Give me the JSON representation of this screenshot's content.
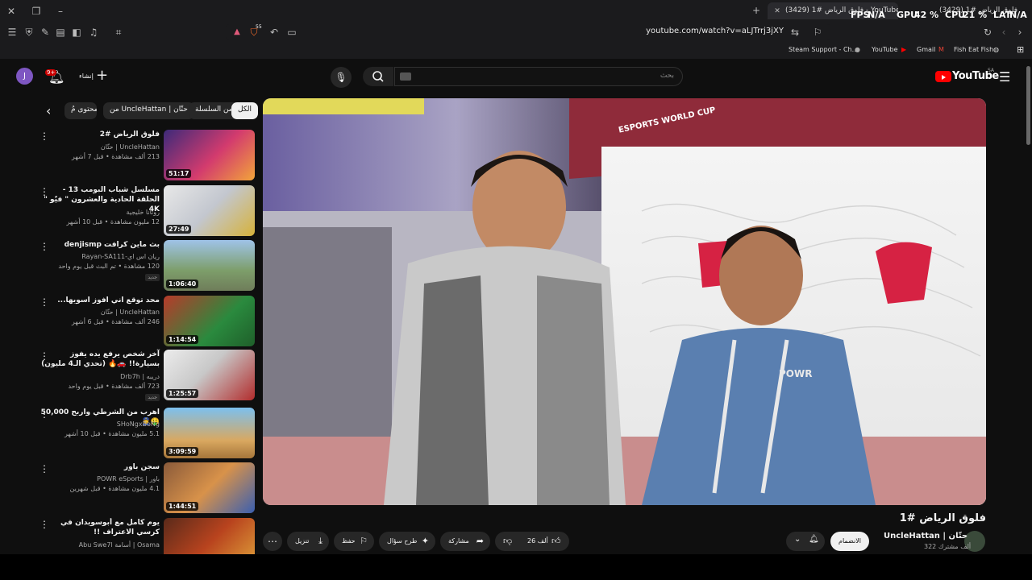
{
  "browser": {
    "tabs": [
      {
        "title": "(3429) فلوق الرياض #1 - YouTube",
        "active": true
      },
      {
        "title": "(3429) فلوق الرياض #1",
        "active": false
      }
    ],
    "perf": {
      "fps_label": "FPS",
      "fps_value": "N/A",
      "gpu_label": "GPU",
      "gpu_value": "42 %",
      "cpu_label": "CPU",
      "cpu_value": "21 %",
      "lat_label": "LAT",
      "lat_value": "N/A"
    },
    "url": "youtube.com/watch?v=aLJTrrj3jXY",
    "shield_count": "55",
    "bookmarks": [
      "Steam Support - Ch...",
      "YouTube",
      "Gmail",
      "Fish Eat Fish"
    ]
  },
  "header": {
    "logo_text": "YouTube",
    "logo_region": "SA",
    "search_placeholder": "بحث",
    "create_label": "إنشاء",
    "notif_count": "9+",
    "avatar_letter": "J"
  },
  "chips": [
    "الكل",
    "من السلسلة",
    "من UncleHattan | حتّان",
    "محتوى مُ"
  ],
  "videos": [
    {
      "title": "فلوق الرياض #2",
      "channel": "UncleHattan | حتّان",
      "meta": "213 ألف مشاهدة • قبل 7 أشهر",
      "duration": "51:17",
      "badge": ""
    },
    {
      "title": "مسلسل شباب البومب 13 - الحلقة الحادية والعشرون \" فيّو \" 4K",
      "channel": "روتانا خليجية",
      "meta": "12 مليون مشاهدة • قبل 10 أشهر",
      "duration": "27:49",
      "badge": ""
    },
    {
      "title": "بث ماين كرافت denjismp",
      "channel": "ريان اس اي-Rayan-SA111",
      "meta": "120 مشاهدة • تم البث قبل يوم واحد",
      "duration": "1:06:40",
      "badge": "جديد"
    },
    {
      "title": "محد توقع اني افوز اسويها...",
      "channel": "UncleHattan | حتّان",
      "meta": "246 ألف مشاهدة • قبل 6 أشهر",
      "duration": "1:14:54",
      "badge": ""
    },
    {
      "title": "آخر شخص يرفع يده يفوز بسيارة!! 🚗🔥 (تحدي الـ4 مليون)",
      "channel": "دريبه | Drb7h",
      "meta": "723 ألف مشاهدة • قبل يوم واحد",
      "duration": "1:25:57",
      "badge": "جديد"
    },
    {
      "title": "اهرب من الشرطي واربح 50,000 🤑👮",
      "channel": "SHoNgxBoNg",
      "meta": "5.1 مليون مشاهدة • قبل 10 أشهر",
      "duration": "3:09:59",
      "badge": ""
    },
    {
      "title": "سجن باور",
      "channel": "باور | POWR eSports",
      "meta": "4.1 مليون مشاهدة • قبل شهرين",
      "duration": "1:44:51",
      "badge": ""
    },
    {
      "title": "يوم كامل مع أبوسويدان في كرسي الاعتراف !!",
      "channel": "Osama | أسامة Abu Swe7l",
      "meta": "",
      "duration": "",
      "badge": ""
    }
  ],
  "main_video": {
    "title": "فلوق الرياض #1",
    "channel": "UncleHattan | حتّان",
    "subscribers": "322 ألف مشترك",
    "join_label": "الانضمام",
    "likes": "26 ألف",
    "share_label": "مشاركة",
    "ask_label": "طرح سؤال",
    "save_label": "حفظ",
    "download_label": "تنزيل",
    "booth_text": "ESPORTS WORLD CUP",
    "brand_text": "POWR"
  }
}
